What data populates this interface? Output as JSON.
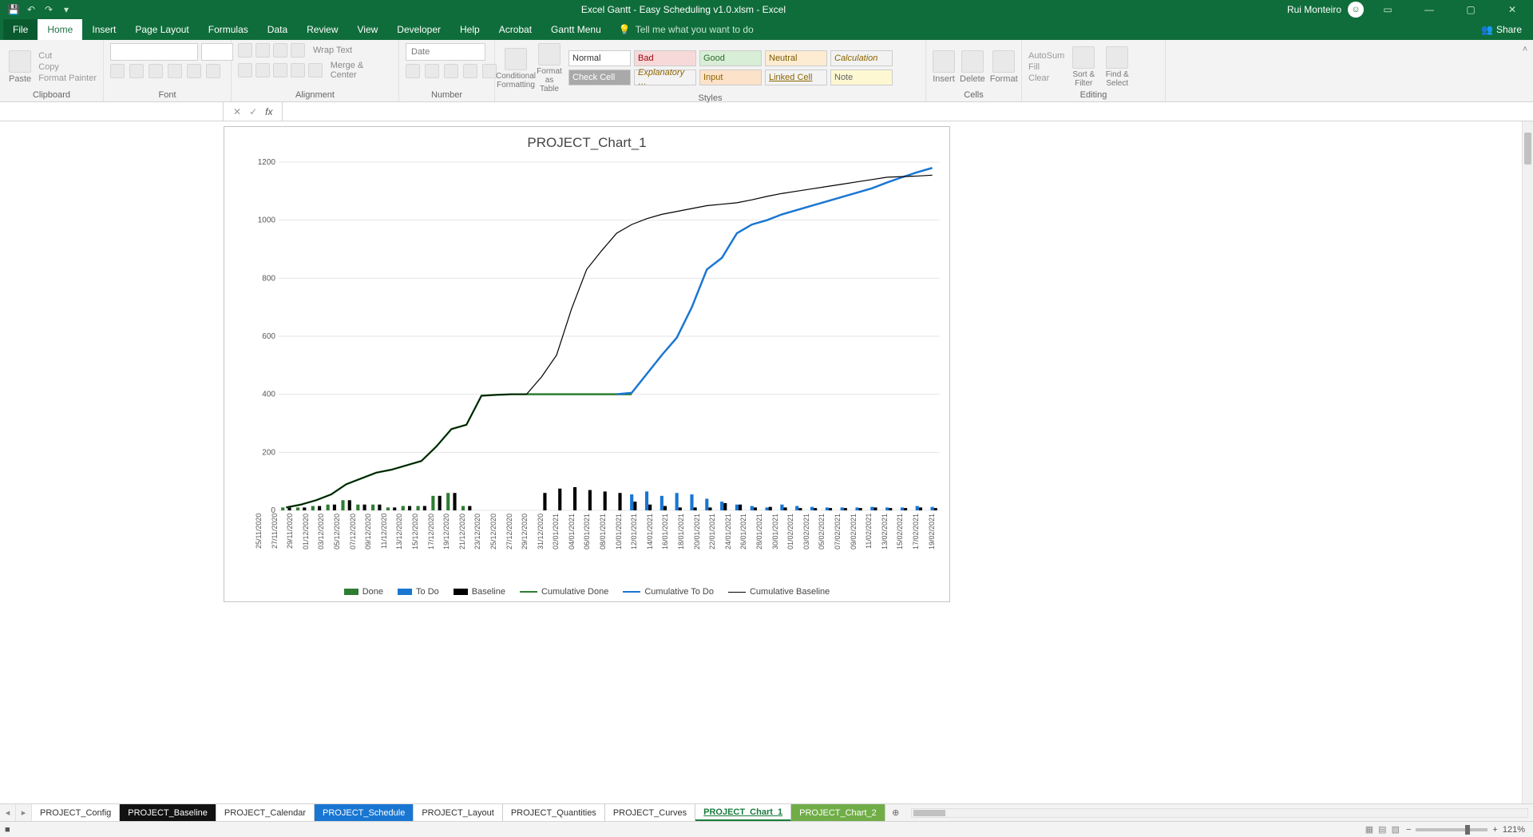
{
  "titlebar": {
    "title": "Excel Gantt - Easy Scheduling v1.0.xlsm  -  Excel",
    "user": "Rui Monteiro"
  },
  "tabs": {
    "file": "File",
    "home": "Home",
    "insert": "Insert",
    "page_layout": "Page Layout",
    "formulas": "Formulas",
    "data": "Data",
    "review": "Review",
    "view": "View",
    "developer": "Developer",
    "help": "Help",
    "acrobat": "Acrobat",
    "gantt": "Gantt Menu",
    "tellme": "Tell me what you want to do",
    "share": "Share"
  },
  "ribbon": {
    "clipboard": {
      "label": "Clipboard",
      "cut": "Cut",
      "copy": "Copy",
      "format_painter": "Format Painter",
      "paste": "Paste"
    },
    "font": {
      "label": "Font"
    },
    "alignment": {
      "label": "Alignment",
      "wrap": "Wrap Text",
      "merge": "Merge & Center"
    },
    "number": {
      "label": "Number",
      "box": "Date"
    },
    "styles": {
      "label": "Styles",
      "cond": "Conditional Formatting",
      "table": "Format as Table",
      "normal": "Normal",
      "bad": "Bad",
      "good": "Good",
      "neutral": "Neutral",
      "calc": "Calculation",
      "check": "Check Cell",
      "expl": "Explanatory …",
      "input": "Input",
      "link": "Linked Cell",
      "note": "Note"
    },
    "cells": {
      "label": "Cells",
      "insert": "Insert",
      "delete": "Delete",
      "format": "Format"
    },
    "editing": {
      "label": "Editing",
      "autosum": "AutoSum",
      "fill": "Fill",
      "clear": "Clear",
      "sort": "Sort & Filter",
      "find": "Find & Select"
    }
  },
  "formula_bar": {
    "namebox": "",
    "fx": "fx"
  },
  "sheets": [
    "PROJECT_Config",
    "PROJECT_Baseline",
    "PROJECT_Calendar",
    "PROJECT_Schedule",
    "PROJECT_Layout",
    "PROJECT_Quantities",
    "PROJECT_Curves",
    "PROJECT_Chart_1",
    "PROJECT_Chart_2"
  ],
  "statusbar": {
    "zoom": "121%"
  },
  "legend": {
    "done": "Done",
    "todo": "To Do",
    "baseline": "Baseline",
    "cdone": "Cumulative Done",
    "ctodo": "Cumulative To Do",
    "cbase": "Cumulative Baseline"
  },
  "chart_data": {
    "type": "bar+line",
    "title": "PROJECT_Chart_1",
    "ylabel": "",
    "xlabel": "",
    "ylim": [
      0,
      1200
    ],
    "yticks": [
      0,
      200,
      400,
      600,
      800,
      1000,
      1200
    ],
    "categories": [
      "25/11/2020",
      "27/11/2020",
      "29/11/2020",
      "01/12/2020",
      "03/12/2020",
      "05/12/2020",
      "07/12/2020",
      "09/12/2020",
      "11/12/2020",
      "13/12/2020",
      "15/12/2020",
      "17/12/2020",
      "19/12/2020",
      "21/12/2020",
      "23/12/2020",
      "25/12/2020",
      "27/12/2020",
      "29/12/2020",
      "31/12/2020",
      "02/01/2021",
      "04/01/2021",
      "06/01/2021",
      "08/01/2021",
      "10/01/2021",
      "12/01/2021",
      "14/01/2021",
      "16/01/2021",
      "18/01/2021",
      "20/01/2021",
      "22/01/2021",
      "24/01/2021",
      "26/01/2021",
      "28/01/2021",
      "30/01/2021",
      "01/02/2021",
      "03/02/2021",
      "05/02/2021",
      "07/02/2021",
      "09/02/2021",
      "11/02/2021",
      "13/02/2021",
      "15/02/2021",
      "17/02/2021",
      "19/02/2021"
    ],
    "bar_series": [
      {
        "name": "Done",
        "color": "#2e7d32",
        "values": [
          10,
          10,
          15,
          20,
          35,
          20,
          20,
          10,
          15,
          15,
          50,
          60,
          15,
          0,
          0,
          0,
          0,
          0,
          0,
          0,
          0,
          0,
          0,
          0,
          0,
          0,
          0,
          0,
          0,
          0,
          0,
          0,
          0,
          0,
          0,
          0,
          0,
          0,
          0,
          0,
          0,
          0,
          0,
          0
        ]
      },
      {
        "name": "To Do",
        "color": "#1976d2",
        "values": [
          0,
          0,
          0,
          0,
          0,
          0,
          0,
          0,
          0,
          0,
          0,
          0,
          0,
          0,
          0,
          0,
          0,
          0,
          0,
          0,
          0,
          0,
          0,
          55,
          65,
          50,
          60,
          55,
          40,
          30,
          20,
          15,
          10,
          20,
          15,
          12,
          10,
          10,
          10,
          12,
          10,
          10,
          15,
          12
        ]
      },
      {
        "name": "Baseline",
        "color": "#000000",
        "values": [
          10,
          10,
          15,
          20,
          35,
          20,
          20,
          10,
          15,
          15,
          50,
          60,
          15,
          0,
          0,
          0,
          0,
          60,
          75,
          80,
          70,
          65,
          60,
          30,
          20,
          15,
          10,
          10,
          10,
          25,
          20,
          10,
          12,
          10,
          8,
          8,
          8,
          8,
          8,
          10,
          8,
          8,
          10,
          8
        ]
      }
    ],
    "line_series": [
      {
        "name": "Cumulative Done",
        "color": "#2e7d32",
        "values": [
          10,
          20,
          35,
          55,
          90,
          110,
          130,
          140,
          155,
          170,
          220,
          280,
          295,
          395,
          398,
          400,
          400,
          400,
          400,
          400,
          400,
          400,
          400,
          400,
          null,
          null,
          null,
          null,
          null,
          null,
          null,
          null,
          null,
          null,
          null,
          null,
          null,
          null,
          null,
          null,
          null,
          null,
          null,
          null
        ]
      },
      {
        "name": "Cumulative To Do",
        "color": "#1976d2",
        "values": [
          null,
          null,
          null,
          null,
          null,
          null,
          null,
          null,
          null,
          null,
          null,
          null,
          null,
          null,
          null,
          null,
          null,
          null,
          null,
          null,
          null,
          null,
          400,
          405,
          470,
          535,
          595,
          700,
          830,
          870,
          955,
          985,
          1000,
          1020,
          1035,
          1050,
          1065,
          1080,
          1095,
          1110,
          1130,
          1148,
          1165,
          1180
        ]
      },
      {
        "name": "Cumulative Baseline",
        "color": "#000000",
        "values": [
          10,
          20,
          35,
          55,
          90,
          110,
          130,
          140,
          155,
          170,
          220,
          280,
          295,
          395,
          398,
          400,
          400,
          460,
          535,
          695,
          830,
          895,
          955,
          985,
          1005,
          1020,
          1030,
          1040,
          1050,
          1055,
          1060,
          1070,
          1082,
          1092,
          1100,
          1108,
          1116,
          1124,
          1132,
          1140,
          1148,
          1150,
          1152,
          1155
        ]
      }
    ]
  }
}
